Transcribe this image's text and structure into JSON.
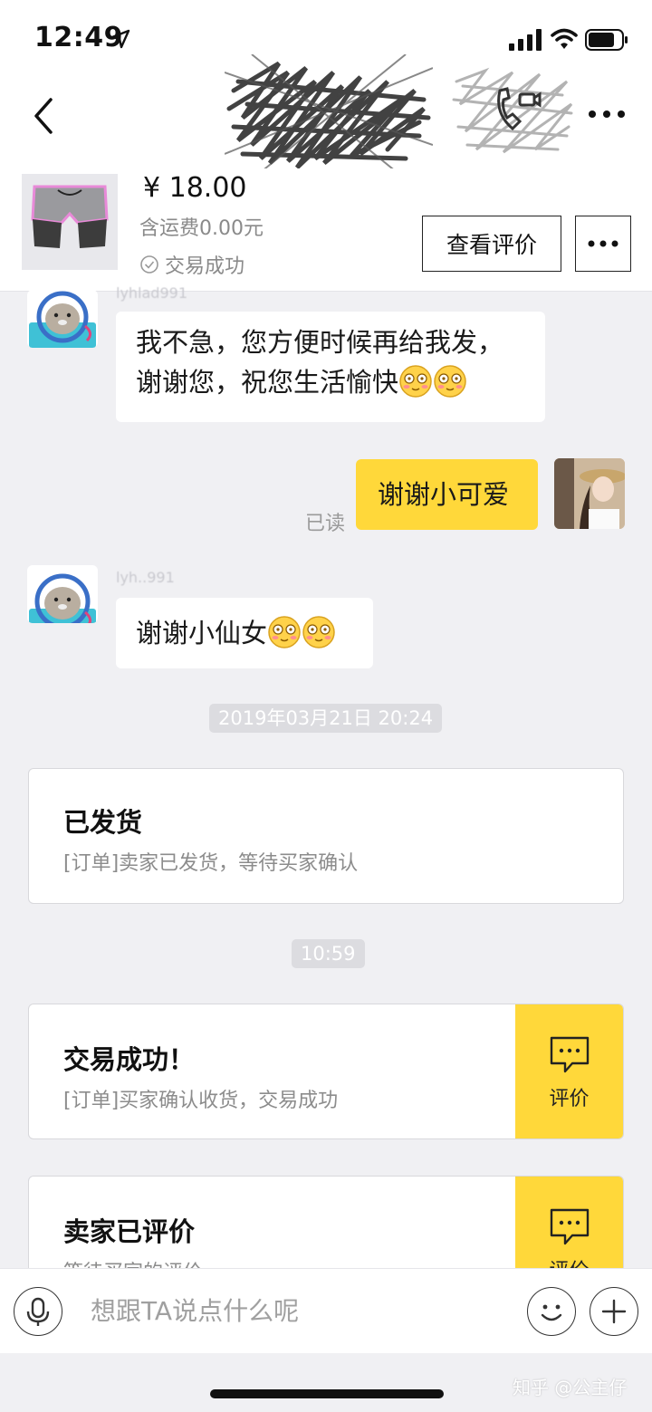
{
  "status_bar": {
    "time": "12:49"
  },
  "product": {
    "price": "¥ 18.00",
    "shipping": "含运费0.00元",
    "status": "交易成功",
    "review_button_label": "查看评价"
  },
  "messages": [
    {
      "sender": "lyhlad991",
      "side": "left",
      "lines": [
        "我不急，您方便时候再给我发，",
        "谢谢您，祝您生活愉快"
      ],
      "emoji_count": 2
    },
    {
      "side": "right",
      "text": "谢谢小可爱",
      "read_label": "已读"
    },
    {
      "sender": "lyh..991",
      "side": "left",
      "text": "谢谢小仙女",
      "emoji_count": 2
    }
  ],
  "timestamps": [
    "2019年03月21日 20:24",
    "10:59"
  ],
  "cards": [
    {
      "title": "已发货",
      "subtitle": "[订单]卖家已发货，等待买家确认"
    },
    {
      "title": "交易成功！",
      "subtitle": "[订单]买家确认收货，交易成功",
      "action_label": "评价"
    },
    {
      "title": "卖家已评价",
      "subtitle": "等待买家的评价",
      "action_label": "评价"
    }
  ],
  "input": {
    "placeholder": "想跟TA说点什么呢"
  },
  "watermark": "知乎 @公主仔",
  "colors": {
    "accent_yellow": "#ffd83a",
    "background": "#f0f0f3",
    "muted_text": "#8c8c8c"
  }
}
